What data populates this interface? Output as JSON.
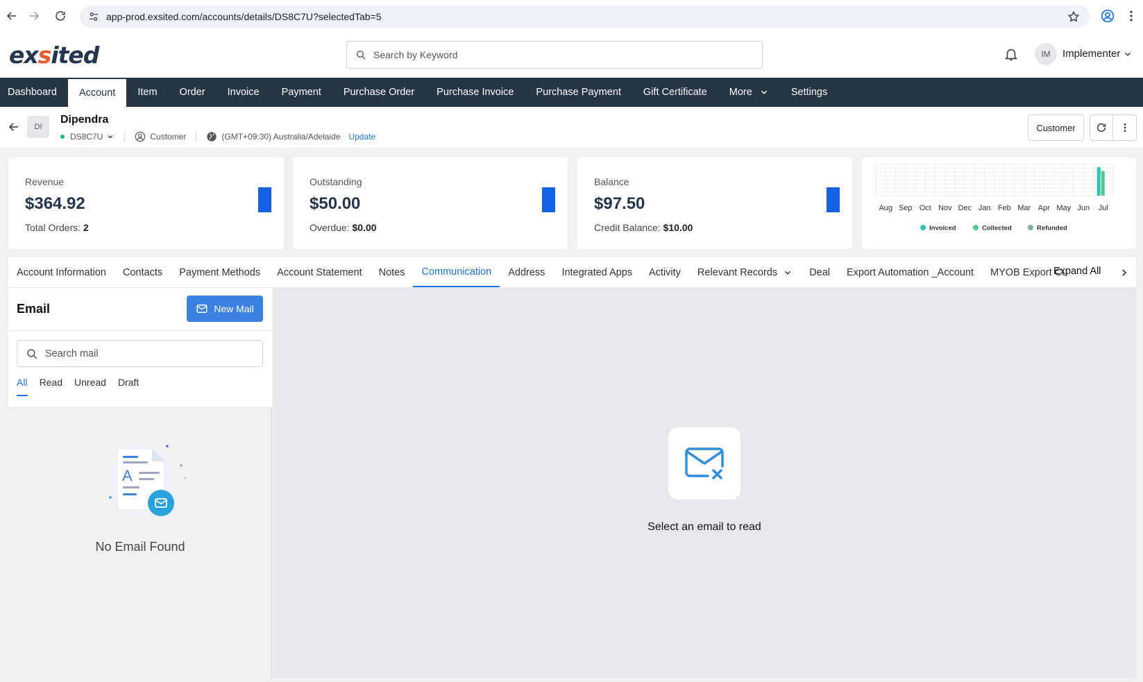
{
  "browser": {
    "url": "app-prod.exsited.com/accounts/details/DS8C7U?selectedTab=5"
  },
  "header": {
    "logo_left": "ex",
    "logo_mid": "s",
    "logo_right": "ited",
    "search_placeholder": "Search by Keyword",
    "user_initials": "IM",
    "user_name": "Implementer"
  },
  "nav": {
    "items": [
      "Dashboard",
      "Account",
      "Item",
      "Order",
      "Invoice",
      "Payment",
      "Purchase Order",
      "Purchase Invoice",
      "Purchase Payment",
      "Gift Certificate",
      "More",
      "Settings"
    ],
    "active": "Account"
  },
  "account": {
    "initials": "DI",
    "name": "Dipendra",
    "id": "DS8C7U",
    "type": "Customer",
    "timezone": "(GMT+09:30) Australia/Adelaide",
    "update_label": "Update",
    "customer_button": "Customer"
  },
  "stats": [
    {
      "label": "Revenue",
      "value": "$364.92",
      "sub_label": "Total Orders: ",
      "sub_value": "2"
    },
    {
      "label": "Outstanding",
      "value": "$50.00",
      "sub_label": "Overdue: ",
      "sub_value": "$0.00"
    },
    {
      "label": "Balance",
      "value": "$97.50",
      "sub_label": "Credit Balance: ",
      "sub_value": "$10.00"
    }
  ],
  "colors": {
    "nav_bg": "#263544",
    "accent": "#1a73e8",
    "stat_bar": "#1463e6",
    "invoiced": "#2ec4b6",
    "collected": "#52c98c",
    "refunded": "#6fb89a"
  },
  "chart_data": {
    "type": "bar",
    "categories": [
      "Aug",
      "Sep",
      "Oct",
      "Nov",
      "Dec",
      "Jan",
      "Feb",
      "Mar",
      "Apr",
      "May",
      "Jun",
      "Jul"
    ],
    "series": [
      {
        "name": "Invoiced",
        "values": [
          0,
          0,
          0,
          0,
          0,
          0,
          0,
          0,
          0,
          0,
          0,
          364.92
        ]
      },
      {
        "name": "Collected",
        "values": [
          0,
          0,
          0,
          0,
          0,
          0,
          0,
          0,
          0,
          0,
          0,
          314.92
        ]
      },
      {
        "name": "Refunded",
        "values": [
          0,
          0,
          0,
          0,
          0,
          0,
          0,
          0,
          0,
          0,
          0,
          0
        ]
      }
    ],
    "ylim": [
      0,
      400
    ],
    "grid": true,
    "legend": "bottom"
  },
  "tabs": {
    "items": [
      "Account Information",
      "Contacts",
      "Payment Methods",
      "Account Statement",
      "Notes",
      "Communication",
      "Address",
      "Integrated Apps",
      "Activity",
      "Relevant Records",
      "Deal",
      "Export Automation _Account",
      "MYOB Export Cus"
    ],
    "active": "Communication",
    "expand_all": "Expand All"
  },
  "email": {
    "title": "Email",
    "new_mail": "New Mail",
    "search_placeholder": "Search mail",
    "filters": [
      "All",
      "Read",
      "Unread",
      "Draft"
    ],
    "active_filter": "All",
    "empty_text": "No Email Found",
    "reading_placeholder": "Select an email to read"
  }
}
